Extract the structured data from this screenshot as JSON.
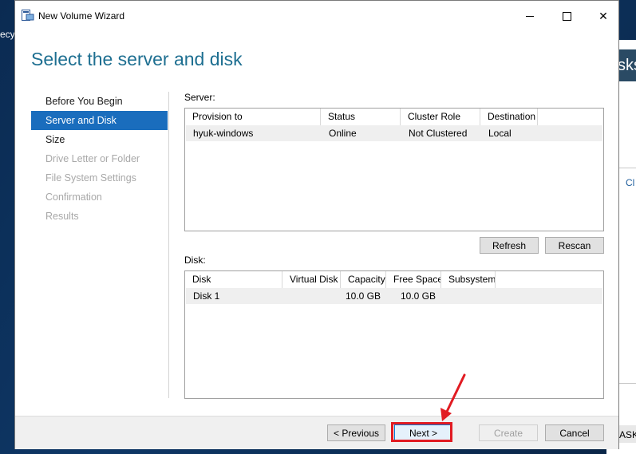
{
  "desktop": {
    "icon_label": "ecyc"
  },
  "background_window": {
    "header_text": "sks",
    "link_text": "Cl",
    "task_text": "ASK"
  },
  "window": {
    "title": "New Volume Wizard",
    "minimize_label": "",
    "maximize_label": "",
    "close_label": "✕"
  },
  "page": {
    "title": "Select the server and disk"
  },
  "nav": {
    "items": [
      {
        "label": "Before You Begin",
        "state": "normal"
      },
      {
        "label": "Server and Disk",
        "state": "active"
      },
      {
        "label": "Size",
        "state": "normal"
      },
      {
        "label": "Drive Letter or Folder",
        "state": "disabled"
      },
      {
        "label": "File System Settings",
        "state": "disabled"
      },
      {
        "label": "Confirmation",
        "state": "disabled"
      },
      {
        "label": "Results",
        "state": "disabled"
      }
    ]
  },
  "server": {
    "label": "Server:",
    "columns": [
      "Provision to",
      "Status",
      "Cluster Role",
      "Destination"
    ],
    "rows": [
      [
        "hyuk-windows",
        "Online",
        "Not Clustered",
        "Local"
      ]
    ],
    "refresh_label": "Refresh",
    "rescan_label": "Rescan"
  },
  "disk": {
    "label": "Disk:",
    "columns": [
      "Disk",
      "Virtual Disk",
      "Capacity",
      "Free Space",
      "Subsystem"
    ],
    "rows": [
      [
        "Disk 1",
        "",
        "10.0 GB",
        "10.0 GB",
        ""
      ]
    ]
  },
  "footer": {
    "previous_label": "< Previous",
    "next_label": "Next >",
    "create_label": "Create",
    "cancel_label": "Cancel"
  },
  "colors": {
    "accent": "#1a6dbd",
    "title": "#1e6f91",
    "highlight": "#e11b22"
  }
}
